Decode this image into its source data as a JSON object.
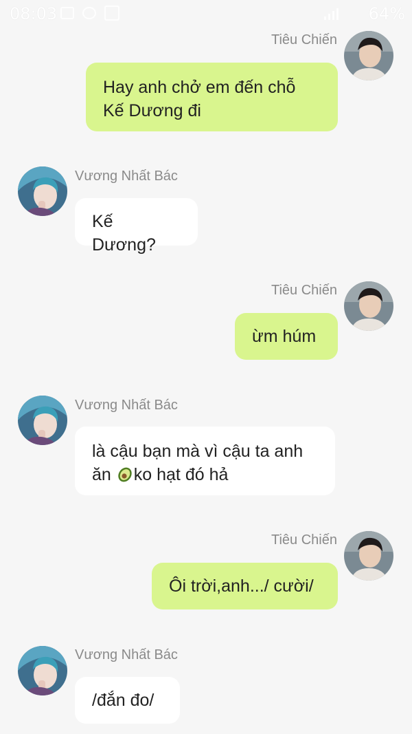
{
  "status_bar": {
    "time": "08:03",
    "battery": "64%",
    "icons": [
      "image-icon",
      "eye-icon",
      "message-icon",
      "data-icon",
      "signal-icon"
    ]
  },
  "colors": {
    "background": "#f6f6f6",
    "outgoing_bubble": "#d9f58e",
    "incoming_bubble": "#ffffff",
    "name_text": "#8a8a8a"
  },
  "messages": [
    {
      "sender": "Tiêu Chiến",
      "direction": "outgoing",
      "lines": [
        "Hay anh chở em đến chỗ",
        "Kế Dương đi"
      ]
    },
    {
      "sender": "Vương Nhất Bác",
      "direction": "incoming",
      "lines": [
        "Kế Dương?"
      ]
    },
    {
      "sender": "Tiêu Chiến",
      "direction": "outgoing",
      "lines": [
        "ừm húm"
      ]
    },
    {
      "sender": "Vương Nhất Bác",
      "direction": "incoming",
      "line1": "là cậu bạn mà vì cậu ta anh",
      "line2_before": "ăn ",
      "emoji": "avocado-icon",
      "line2_after": "ko hạt đó hả"
    },
    {
      "sender": "Tiêu Chiến",
      "direction": "outgoing",
      "lines": [
        "Ôi trời,anh.../ cười/"
      ]
    },
    {
      "sender": "Vương Nhất Bác",
      "direction": "incoming",
      "lines": [
        "/đắn đo/"
      ]
    }
  ]
}
